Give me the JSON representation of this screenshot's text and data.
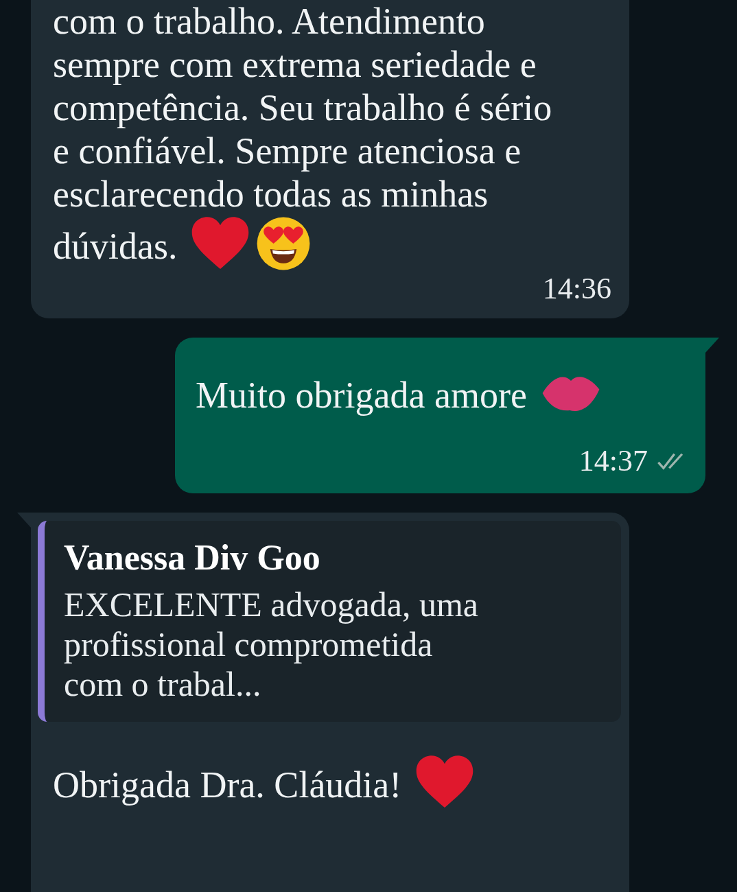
{
  "messages": [
    {
      "kind": "incoming",
      "text": "com o trabalho. Atendimento sempre com extrema seriedade e competência. Seu trabalho é sério e confiável. Sempre atenciosa e esclarecendo todas as minhas dúvidas.",
      "emoji": [
        {
          "kind": "heart"
        },
        {
          "kind": "heart-eyes"
        }
      ],
      "time": "14:36"
    },
    {
      "kind": "outgoing",
      "text": "Muito obrigada amore",
      "emoji": [
        {
          "kind": "lips"
        }
      ],
      "time": "14:37",
      "read": false
    },
    {
      "kind": "reply",
      "quote": {
        "author": "Vanessa Div Goo",
        "text": "EXCELENTE advogada, uma profissional comprometida com o trabal..."
      },
      "text": "Obrigada Dra. Cláudia!",
      "emoji": [
        {
          "kind": "heart"
        }
      ]
    }
  ]
}
